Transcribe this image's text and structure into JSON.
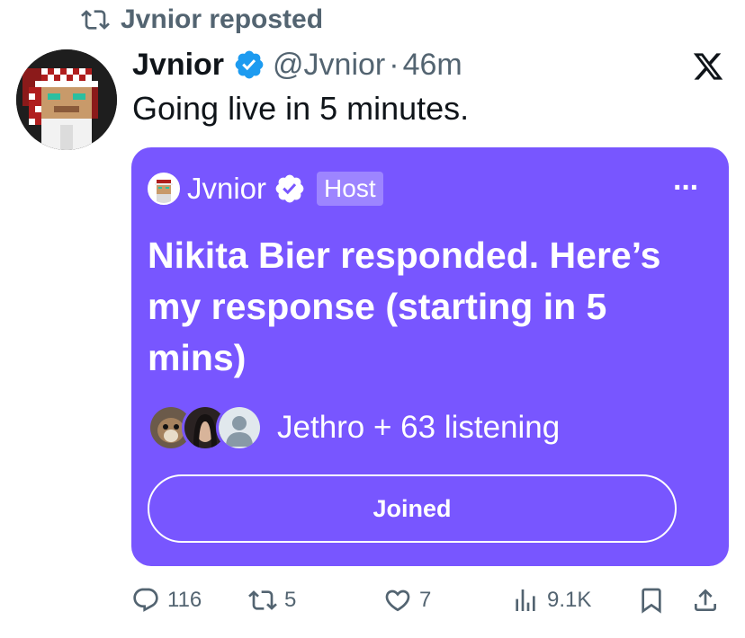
{
  "repost": {
    "label": "Jvnior reposted",
    "icon": "repost-icon"
  },
  "tweet": {
    "author_name": "Jvnior",
    "handle": "@Jvnior",
    "separator": "·",
    "time": "46m",
    "text": "Going live in 5 minutes."
  },
  "space": {
    "host_name": "Jvnior",
    "host_badge": "Host",
    "more": "···",
    "title": "Nikita Bier responded. Here’s my response (starting in 5 mins)",
    "listeners_text": "Jethro + 63 listening",
    "joined_label": "Joined",
    "background_color": "#7856ff"
  },
  "actions": {
    "replies": "116",
    "reposts": "5",
    "likes": "7",
    "views": "9.1K"
  },
  "colors": {
    "verified": "#1d9bf0",
    "muted": "#536471",
    "space": "#7856ff"
  }
}
